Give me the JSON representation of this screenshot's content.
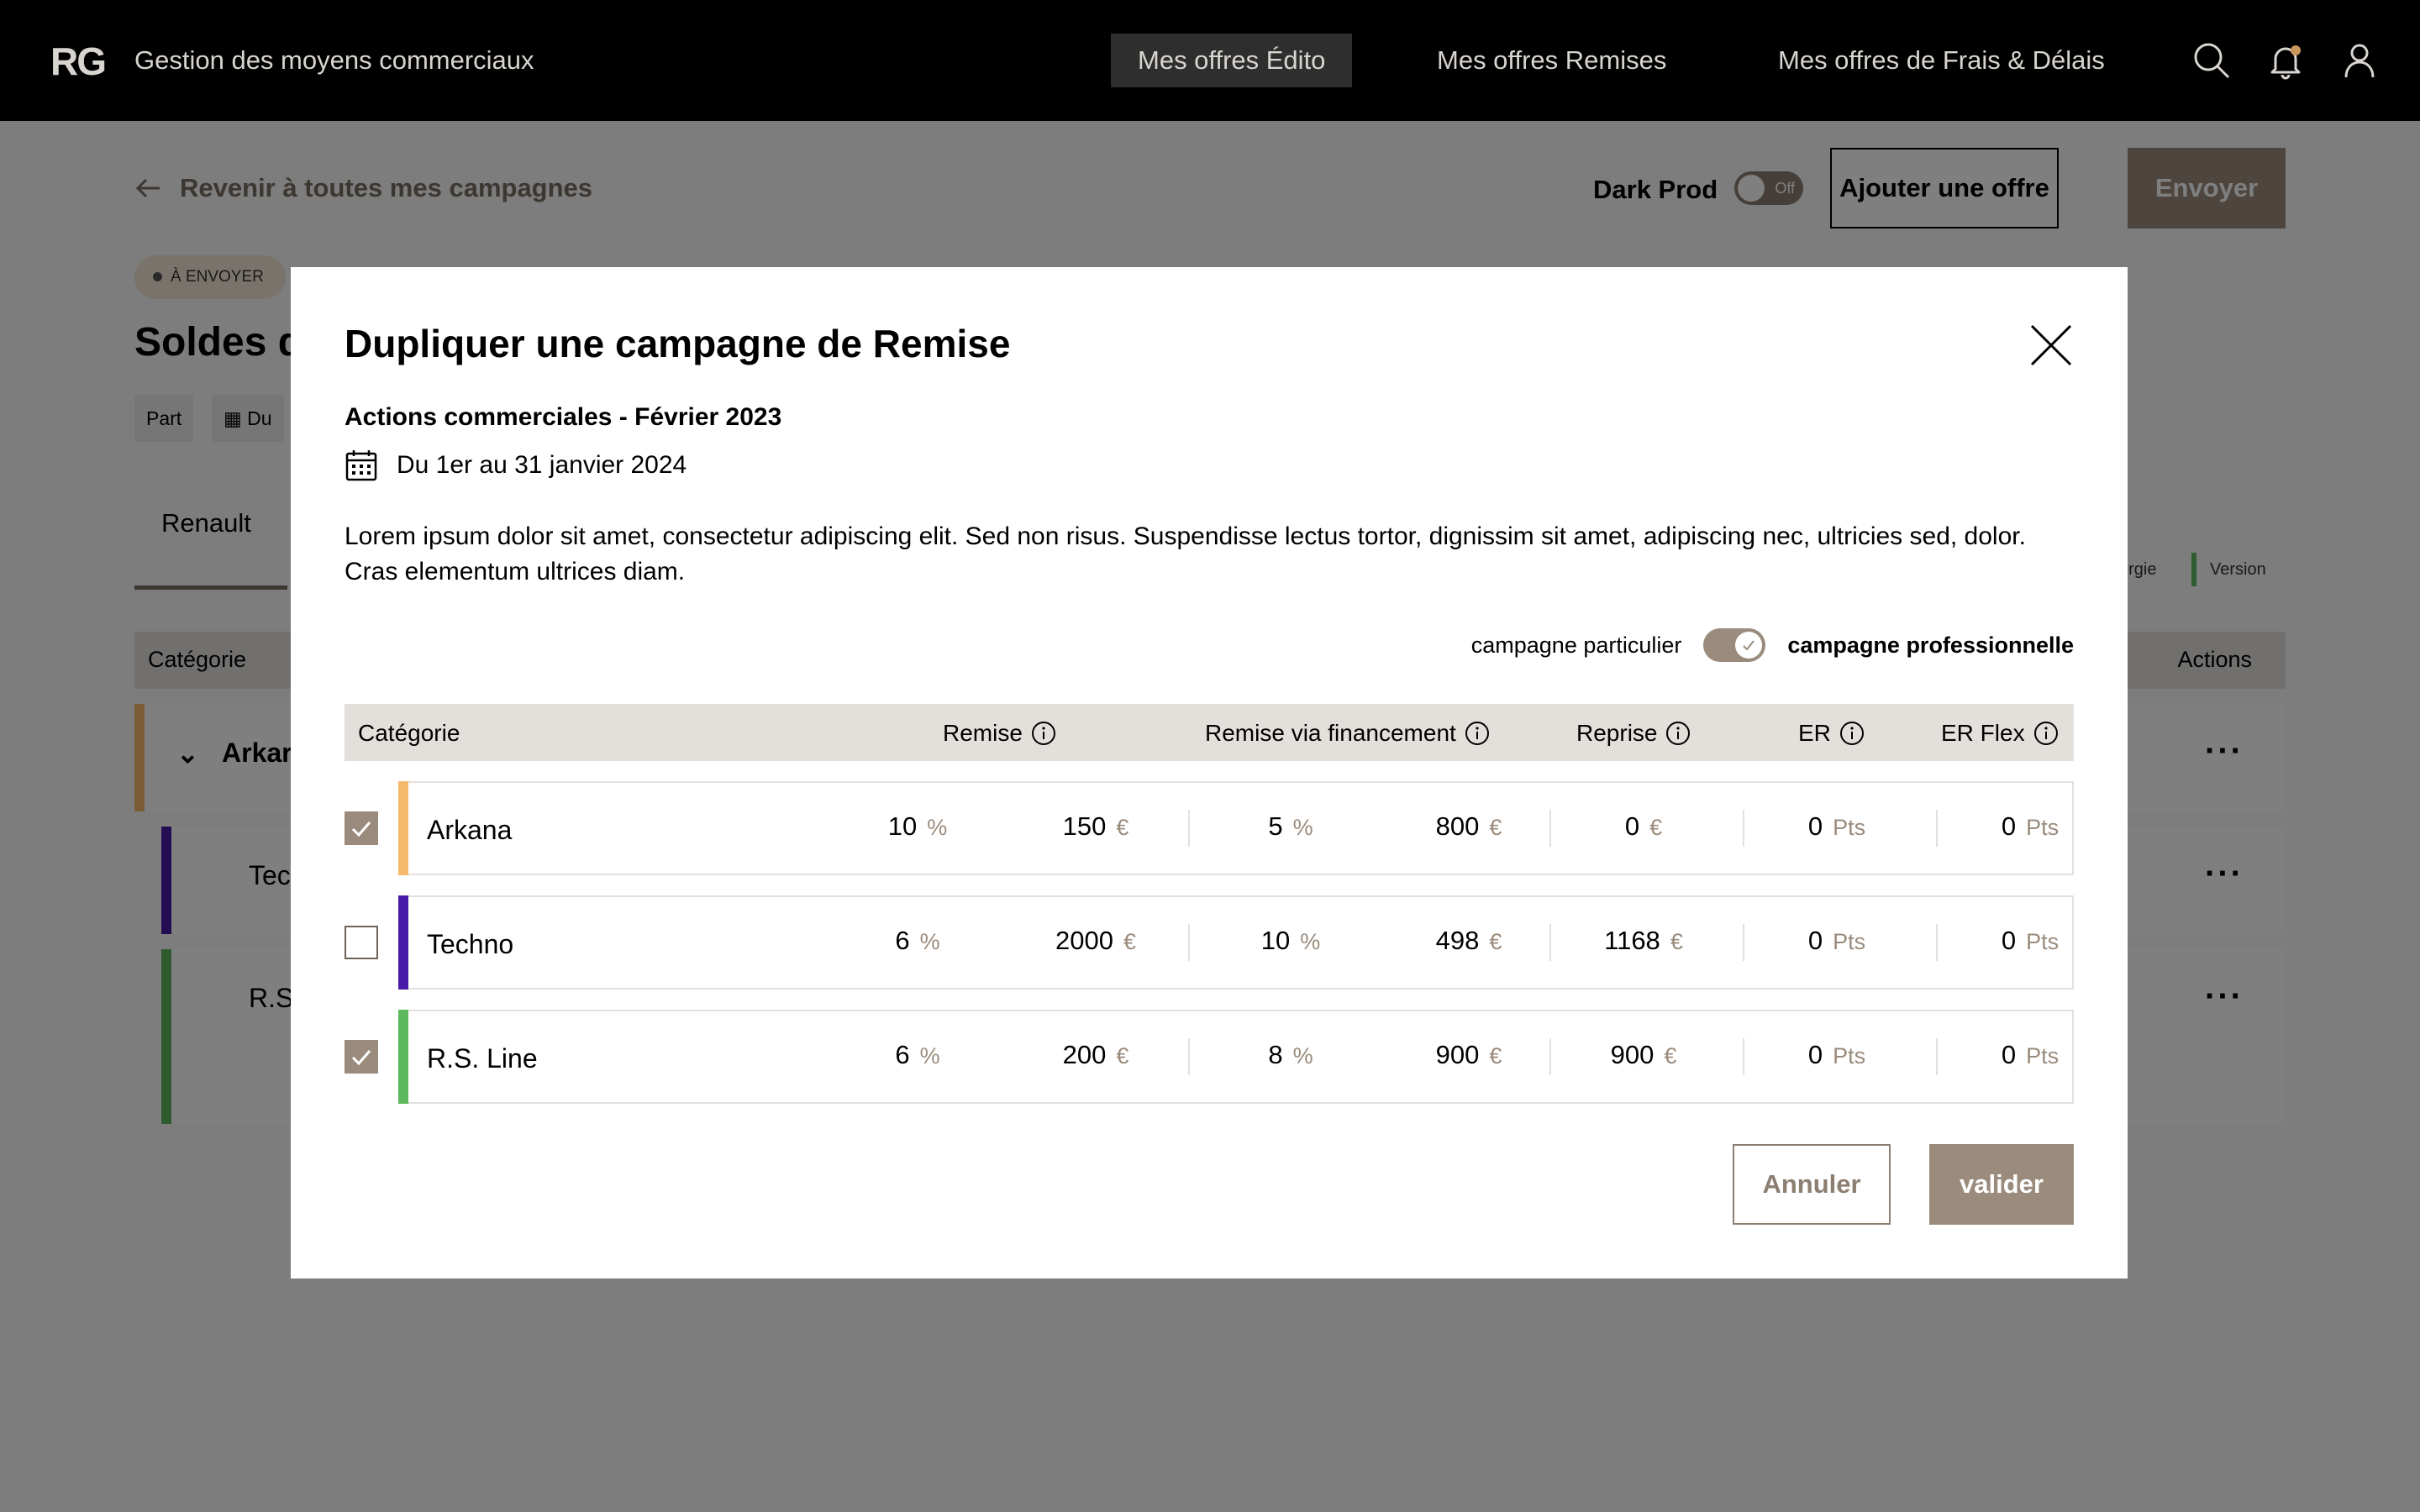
{
  "topnav": {
    "logo": "RG",
    "app_title": "Gestion des moyens commerciaux",
    "tabs": [
      {
        "label": "Mes offres Édito",
        "active": true
      },
      {
        "label": "Mes offres Remises",
        "active": false
      },
      {
        "label": "Mes offres de Frais & Délais",
        "active": false
      }
    ],
    "icons": [
      "search-icon",
      "bell-icon",
      "user-icon"
    ]
  },
  "page": {
    "back_link": "Revenir à toutes mes campagnes",
    "dark_prod_label": "Dark Prod",
    "dark_prod_toggle": "Off",
    "add_offer_label": "Ajouter une offre",
    "send_label": "Envoyer",
    "status_badge": "À ENVOYER",
    "title": "Soldes d",
    "chips": [
      "Part",
      "Du"
    ],
    "tab": "Renault",
    "legend": [
      "ergie",
      "Version"
    ],
    "table_header": {
      "category": "Catégorie",
      "actions": "Actions"
    },
    "rows": [
      "Arkar",
      "Tec",
      "R.S."
    ]
  },
  "modal": {
    "title": "Dupliquer une campagne de Remise",
    "campaign_name": "Actions commerciales - Février 2023",
    "date_range": "Du 1er au 31 janvier 2024",
    "description": "Lorem ipsum dolor sit amet, consectetur adipiscing elit. Sed non risus. Suspendisse lectus tortor, dignissim sit amet, adipiscing nec, ultricies sed, dolor. Cras elementum ultrices diam.",
    "toggle": {
      "left_label": "campagne particulier",
      "right_label": "campagne professionnelle",
      "value": "professionnelle"
    },
    "columns": {
      "category": "Catégorie",
      "remise": "Remise",
      "remise_financement": "Remise via financement",
      "reprise": "Reprise",
      "er": "ER",
      "er_flex": "ER Flex"
    },
    "units": {
      "percent": "%",
      "euro": "€",
      "points": "Pts"
    },
    "rows": [
      {
        "name": "Arkana",
        "checked": true,
        "color": "#f5b96b",
        "remise_pct": "10",
        "remise_eur": "150",
        "fin_pct": "5",
        "fin_eur": "800",
        "reprise": "0",
        "er": "0",
        "er_flex": "0"
      },
      {
        "name": "Techno",
        "checked": false,
        "color": "#4a1aa8",
        "remise_pct": "6",
        "remise_eur": "2000",
        "fin_pct": "10",
        "fin_eur": "498",
        "reprise": "1168",
        "er": "0",
        "er_flex": "0"
      },
      {
        "name": "R.S. Line",
        "checked": true,
        "color": "#5cb85c",
        "remise_pct": "6",
        "remise_eur": "200",
        "fin_pct": "8",
        "fin_eur": "900",
        "reprise": "900",
        "er": "0",
        "er_flex": "0"
      }
    ],
    "cancel_label": "Annuler",
    "validate_label": "valider"
  },
  "colors": {
    "brand": "#9a8b7c",
    "nav_bg": "#000000",
    "table_header_bg": "#e3e0dc"
  }
}
